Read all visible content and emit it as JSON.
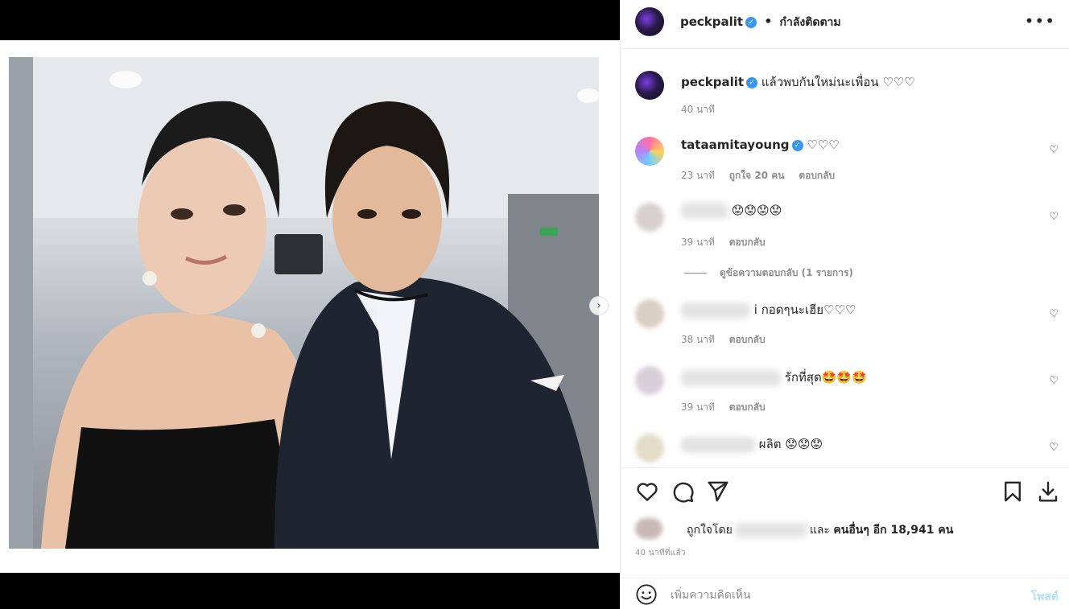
{
  "header": {
    "username": "peckpalit",
    "separator": "•",
    "follow_status": "กำลังติดตาม",
    "more_icon": "more-horizontal-icon"
  },
  "caption": {
    "username": "peckpalit",
    "text": "แล้วพบกันใหม่นะเพื่อน ♡♡♡",
    "time": "40 นาที"
  },
  "comments": [
    {
      "username": "tataamitayoung",
      "verified": true,
      "text": "♡♡♡",
      "time": "23 นาที",
      "likes": "ถูกใจ 20 คน",
      "reply": "ตอบกลับ"
    },
    {
      "username": "",
      "text": "😟😟😟😟",
      "time": "39 นาที",
      "reply": "ตอบกลับ",
      "view_replies": "ดูข้อความตอบกลับ (1 รายการ)"
    },
    {
      "username": "",
      "text": "i กอดๆนะเฮีย♡♡♡",
      "time": "38 นาที",
      "reply": "ตอบกลับ"
    },
    {
      "username": "",
      "text": "รักที่สุด🤩🤩🤩",
      "time": "39 นาที",
      "reply": "ตอบกลับ"
    },
    {
      "username": "",
      "text": "ผลิต 😟😟😟"
    }
  ],
  "likes": {
    "prefix": "ถูกใจโดย",
    "middle": "และ",
    "others": "คนอื่นๆ อีก 18,941 คน"
  },
  "time_ago": "40 นาทีที่แล้ว",
  "add_comment": {
    "placeholder": "เพิ่มความคิดเห็น",
    "post_label": "โพสต์"
  },
  "colors": {
    "verified": "#3897f0",
    "post_disabled": "#b2dffc",
    "secondary_text": "#8e8e8e"
  }
}
